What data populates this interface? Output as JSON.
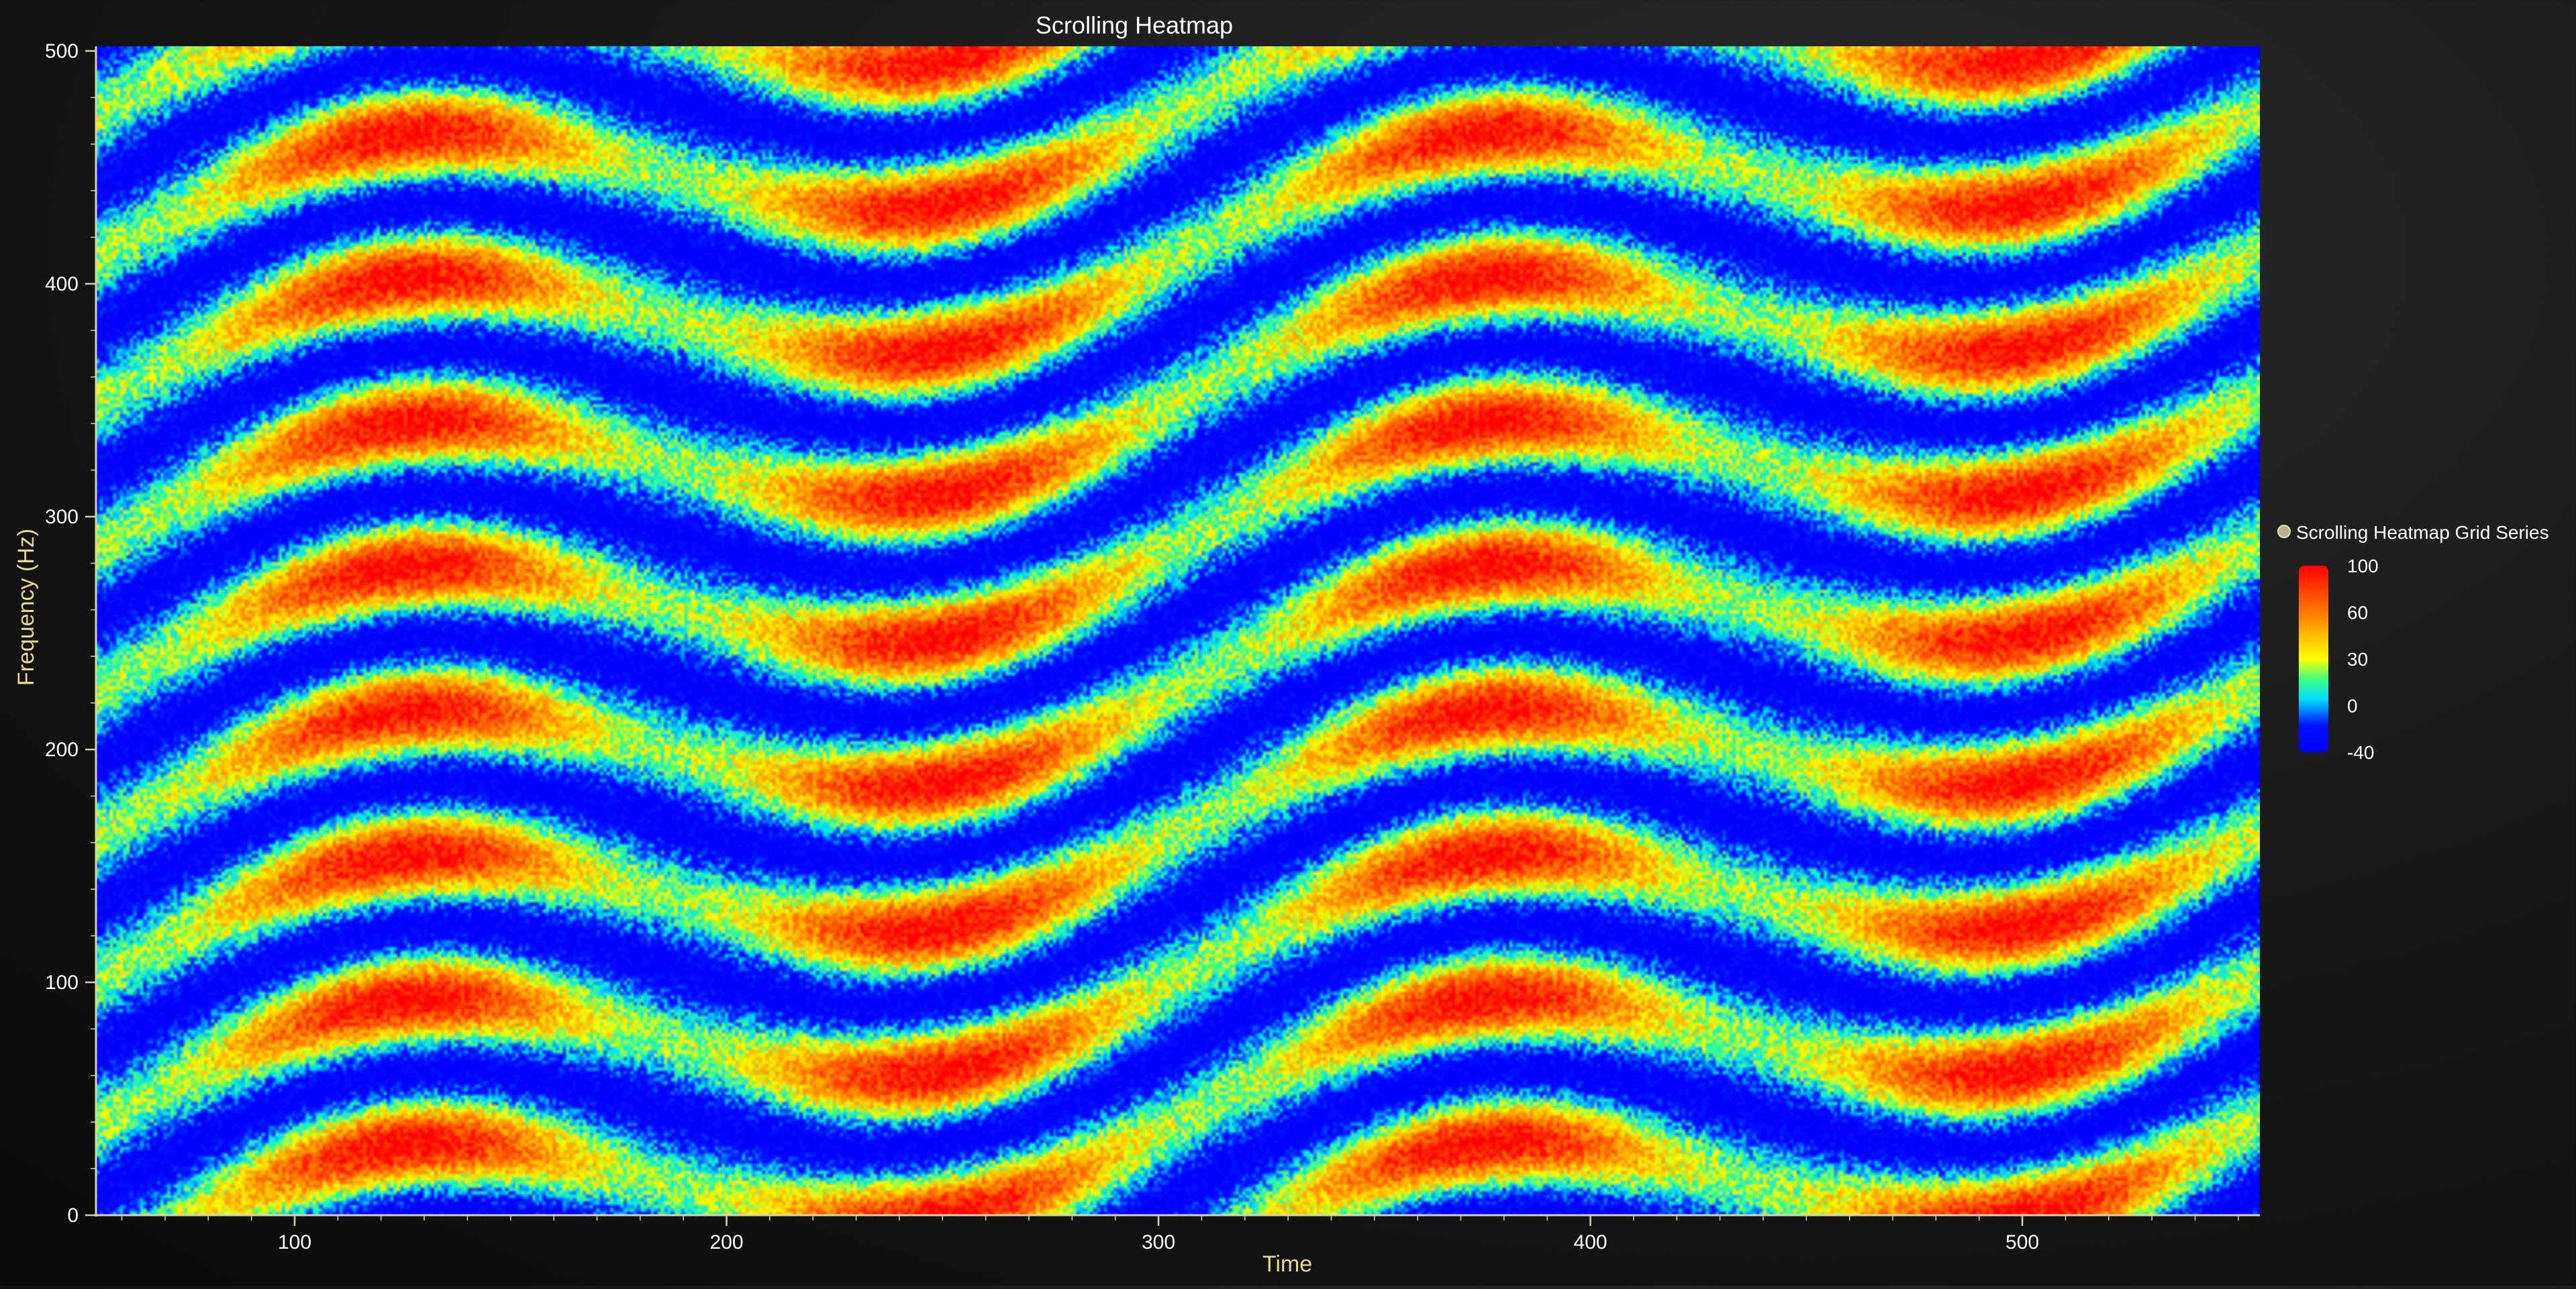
{
  "chart_data": {
    "type": "heatmap",
    "title": "Scrolling Heatmap",
    "xlabel": "Time",
    "ylabel": "Frequency (Hz)",
    "xlim": [
      54,
      555
    ],
    "ylim": [
      0,
      502
    ],
    "x_ticks": [
      100,
      200,
      300,
      400,
      500
    ],
    "y_ticks": [
      0,
      100,
      200,
      300,
      400,
      500
    ],
    "x_tick_labels": [
      "100",
      "200",
      "300",
      "400",
      "500"
    ],
    "y_tick_labels": [
      "0",
      "100",
      "200",
      "300",
      "400",
      "500"
    ],
    "legend": {
      "series_name": "Scrolling Heatmap Grid Series",
      "placement": "right",
      "colorbar_range": [
        -40,
        100
      ],
      "colorbar_ticks": [
        "100",
        "60",
        "30",
        "0",
        "-40"
      ],
      "color_stops": [
        {
          "value": -40,
          "color": "#0000ff"
        },
        {
          "value": -20,
          "color": "#0010ff"
        },
        {
          "value": 0,
          "color": "#00e0ff"
        },
        {
          "value": 15,
          "color": "#40ff80"
        },
        {
          "value": 30,
          "color": "#ffff00"
        },
        {
          "value": 60,
          "color": "#ff8c00"
        },
        {
          "value": 100,
          "color": "#ff0000"
        }
      ]
    },
    "pattern": {
      "description_values": {
        "frequency_band_spacing_hz": 62,
        "time_period": 250,
        "phase_drift_hz": 31,
        "value_min": -40,
        "value_max": 100
      }
    },
    "colors": {
      "axis": "#d8d2a8",
      "tick_label": "#ffffff",
      "title": "#ffffff",
      "axis_label": "#e6d98a"
    }
  }
}
